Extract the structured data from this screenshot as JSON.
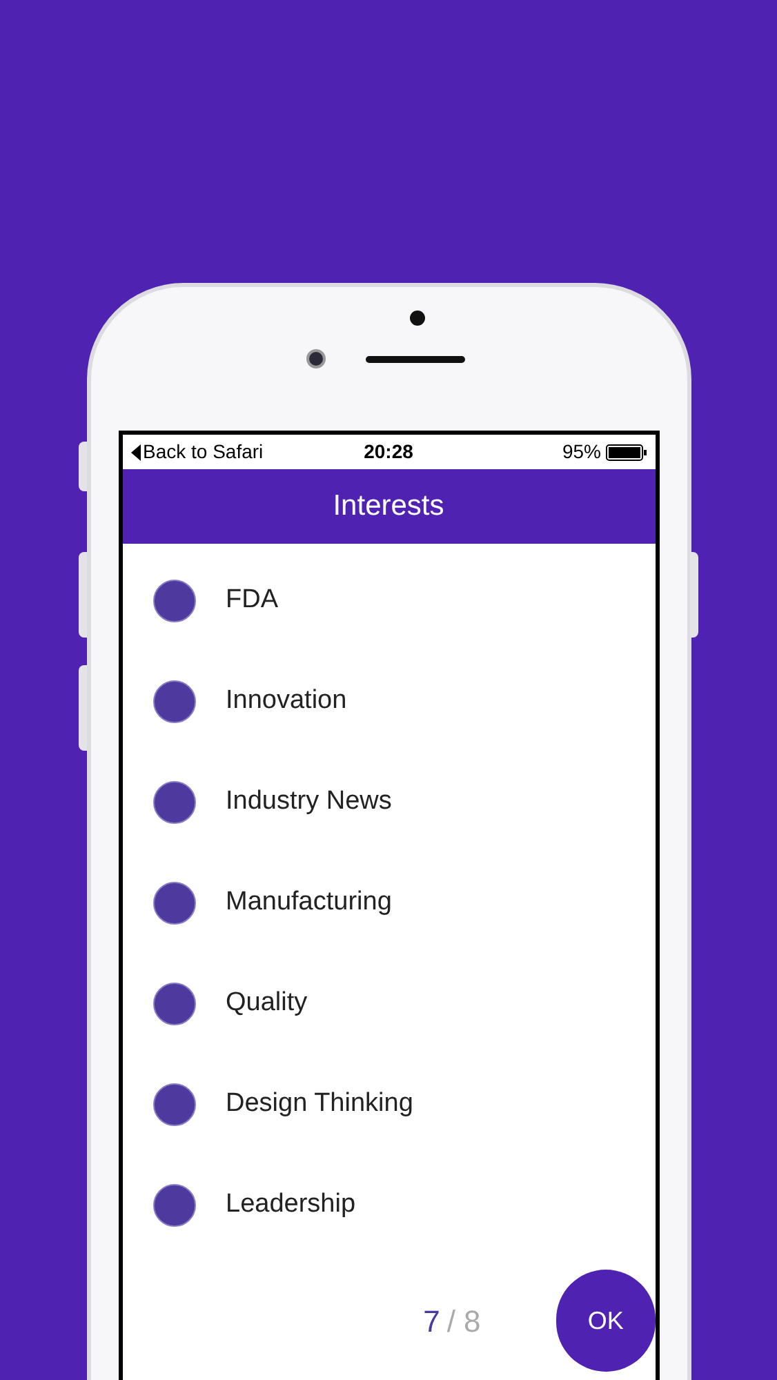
{
  "status_bar": {
    "back": "Back to Safari",
    "time": "20:28",
    "battery": "95%"
  },
  "header": {
    "title": "Interests"
  },
  "interests": [
    {
      "label": "FDA"
    },
    {
      "label": "Innovation"
    },
    {
      "label": "Industry News"
    },
    {
      "label": "Manufacturing"
    },
    {
      "label": "Quality"
    },
    {
      "label": "Design Thinking"
    },
    {
      "label": "Leadership"
    }
  ],
  "footer": {
    "current": "7",
    "total": "/ 8",
    "button": "OK"
  }
}
